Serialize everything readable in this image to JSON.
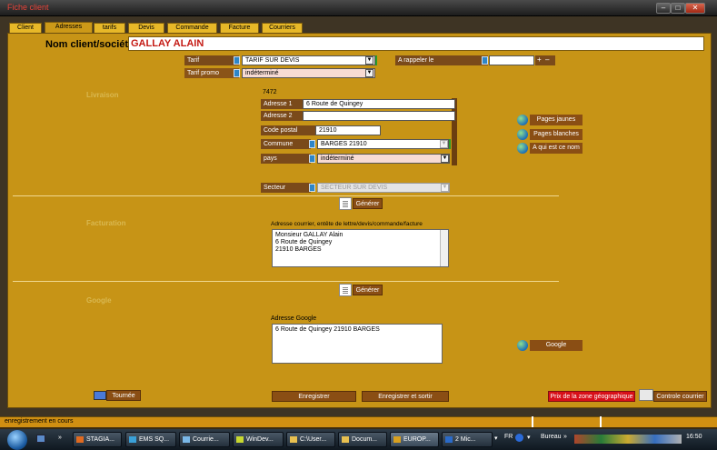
{
  "window": {
    "title": "Fiche client",
    "minimize": "–",
    "maximize": "□",
    "close": "✕"
  },
  "tabs": [
    "Client",
    "Adresses",
    "tarifs",
    "Devis",
    "Commande",
    "Facture",
    "Courriers"
  ],
  "header": {
    "label": "Nom client/société",
    "value": "GALLAY ALAIN"
  },
  "tarif": {
    "tarif_label": "Tarif",
    "tarif_value": "TARIF SUR DEVIS",
    "promo_label": "Tarif promo",
    "promo_value": "indéterminé"
  },
  "rappel": {
    "label": "A rappeler le",
    "value": "",
    "plus": "+",
    "minus": "–"
  },
  "livraison": {
    "section": "Livraison",
    "code": "7472",
    "adresse1_label": "Adresse 1",
    "adresse1_value": "6 Route de Quingey",
    "adresse2_label": "Adresse 2",
    "adresse2_value": "",
    "cp_label": "Code postal",
    "cp_value": "21910",
    "commune_label": "Commune",
    "commune_value": "BARGES 21910",
    "pays_label": "pays",
    "pays_value": "indéterminé",
    "secteur_label": "Secteur",
    "secteur_value": "SECTEUR SUR DEVIS",
    "generer": "Générer"
  },
  "side_buttons": [
    "Pages jaunes",
    "Pages blanches",
    "A qui est ce nom"
  ],
  "facturation": {
    "section": "Facturation",
    "caption": "Adresse courrier, entête de lettre/devis/commande/facture",
    "lines": [
      "Monsieur GALLAY Alain",
      "6 Route de Quingey",
      "21910 BARGES"
    ],
    "generer": "Générer"
  },
  "google": {
    "section": "Google",
    "caption": "Adresse Google",
    "value": "6 Route de Quingey   21910 BARGES",
    "button": "Google"
  },
  "bottom": {
    "tournee": "Tournée",
    "enregistrer": "Enregistrer",
    "enregistrer_sortir": "Enregistrer et sortir",
    "prix_zone": "Prix de la zone géographique",
    "controle": "Controle courrier"
  },
  "status": "enregistrement en cours",
  "taskbar": {
    "items": [
      "STAGIA...",
      "EMS SQ...",
      "Courrie...",
      "WinDev...",
      "C:\\User...",
      "Docum...",
      "EUROP...",
      "2 Mic..."
    ],
    "lang": "FR",
    "bureau": "Bureau",
    "clock": "16:50"
  },
  "colors": {
    "panel": "#c79416",
    "label": "#7a4a1a",
    "accent_red": "#c41a14",
    "prix_button": "#d8101a"
  }
}
